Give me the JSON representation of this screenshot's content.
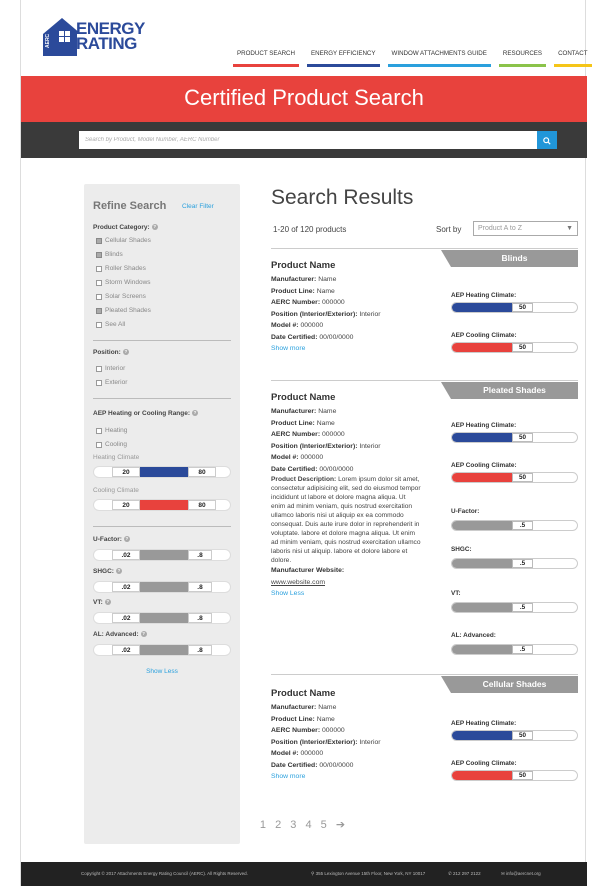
{
  "brand": {
    "aerc": "AERC",
    "line1": "ENERGY",
    "line2": "RATING",
    "blue": "#2b4a9a",
    "red": "#e8423d",
    "accent": "#2aa0dd"
  },
  "nav": [
    {
      "label": "PRODUCT SEARCH",
      "color": "#e8423d"
    },
    {
      "label": "ENERGY EFFICIENCY",
      "color": "#2b4a9a"
    },
    {
      "label": "WINDOW ATTACHMENTS GUIDE",
      "color": "#2aa0dd"
    },
    {
      "label": "RESOURCES",
      "color": "#8bc34a"
    },
    {
      "label": "CONTACT",
      "color": "#f5c518"
    }
  ],
  "hero": {
    "title": "Certified Product Search"
  },
  "search": {
    "placeholder": "Search by Product, Model Number, AERC Number",
    "button_icon": "search-icon"
  },
  "sidebar": {
    "title": "Refine Search",
    "clear": "Clear Filter",
    "product_category": {
      "label": "Product Category:",
      "options": [
        {
          "label": "Cellular Shades",
          "checked": true
        },
        {
          "label": "Blinds",
          "checked": true
        },
        {
          "label": "Roller Shades",
          "checked": false
        },
        {
          "label": "Storm Windows",
          "checked": false
        },
        {
          "label": "Solar Screens",
          "checked": false
        },
        {
          "label": "Pleated Shades",
          "checked": true
        },
        {
          "label": "See All",
          "checked": false
        }
      ]
    },
    "position": {
      "label": "Position:",
      "options": [
        {
          "label": "Interior",
          "checked": false
        },
        {
          "label": "Exterior",
          "checked": false
        }
      ]
    },
    "aep": {
      "label": "AEP Heating or Cooling Range:",
      "options": [
        {
          "label": "Heating",
          "checked": false
        },
        {
          "label": "Cooling",
          "checked": false
        }
      ],
      "heating_label": "Heating Climate",
      "heating_min": "20",
      "heating_max": "80",
      "cooling_label": "Cooling Climate",
      "cooling_min": "20",
      "cooling_max": "80"
    },
    "ufactor": {
      "label": "U-Factor:",
      "min": ".02",
      "max": ".8"
    },
    "shgc": {
      "label": "SHGC:",
      "min": ".02",
      "max": ".8"
    },
    "vt": {
      "label": "VT:",
      "min": ".02",
      "max": ".8"
    },
    "al": {
      "label": "AL: Advanced:",
      "min": ".02",
      "max": ".8"
    },
    "show_less": "Show Less"
  },
  "results": {
    "title": "Search Results",
    "count": "1-20 of 120 products",
    "sort_label": "Sort by",
    "sort_value": "Product A to Z"
  },
  "labels": {
    "manufacturer": "Manufacturer:",
    "product_line": "Product Line:",
    "aerc_number": "AERC Number:",
    "position": "Position (Interior/Exterior):",
    "model": "Model #:",
    "date": "Date Certified:",
    "description": "Product Description:",
    "website": "Manufacturer Website:",
    "heating": "AEP Heating Climate:",
    "cooling": "AEP Cooling Climate:",
    "ufactor": "U-Factor:",
    "shgc": "SHGC:",
    "vt": "VT:",
    "al": "AL: Advanced:"
  },
  "products": [
    {
      "name": "Product Name",
      "category": "Blinds",
      "manufacturer": "Name",
      "product_line": "Name",
      "aerc_number": "000000",
      "position": "Interior",
      "model": "000000",
      "date": "00/00/0000",
      "toggle": "Show more",
      "heating": "50",
      "cooling": "50"
    },
    {
      "name": "Product Name",
      "category": "Pleated Shades",
      "manufacturer": "Name",
      "product_line": "Name",
      "aerc_number": "000000",
      "position": "Interior",
      "model": "000000",
      "date": "00/00/0000",
      "description": "Lorem ipsum dolor sit amet, consectetur adipisicing elit, sed do eiusmod tempor incididunt ut labore et dolore magna aliqua. Ut enim ad minim veniam, quis nostrud exercitation ullamco laboris nisi ut aliquip ex ea commodo consequat. Duis aute irure dolor in reprehenderit in voluptate. labore et dolore magna aliqua. Ut enim ad minim veniam, quis nostrud exercitation ullamco laboris nisi ut aliquip. labore et dolore labore et dolore.",
      "website": "www.website.com",
      "toggle": "Show Less",
      "heating": "50",
      "cooling": "50",
      "ufactor": ".5",
      "shgc": ".5",
      "vt": ".5",
      "al": ".5"
    },
    {
      "name": "Product Name",
      "category": "Cellular Shades",
      "manufacturer": "Name",
      "product_line": "Name",
      "aerc_number": "000000",
      "position": "Interior",
      "model": "000000",
      "date": "00/00/0000",
      "toggle": "Show more",
      "heating": "50",
      "cooling": "50"
    }
  ],
  "pagination": {
    "pages": [
      "1",
      "2",
      "3",
      "4",
      "5"
    ],
    "next": "➔"
  },
  "footer": {
    "copyright": "Copyright © 2017 Attachments Energy Rating Council (AERC). All Rights Reserved.",
    "address": "355 Lexington Avenue 15th Floor, New York, NY 10017",
    "phone": "212 297 2122",
    "email": "info@aercnet.org"
  }
}
